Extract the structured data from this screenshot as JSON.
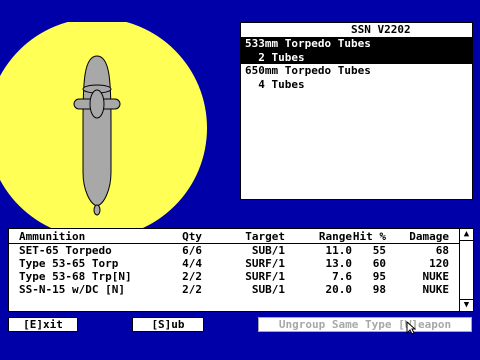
{
  "colors": {
    "background": "#0000a8",
    "sun": "#ffff55",
    "hull": "#a8a8a8",
    "panel": "#ffffff"
  },
  "mounts": {
    "title": "SSN V2202",
    "items": [
      {
        "name": "533mm Torpedo Tubes",
        "count": "2 Tubes",
        "selected": true
      },
      {
        "name": "650mm Torpedo Tubes",
        "count": "4 Tubes",
        "selected": false
      }
    ]
  },
  "ammo": {
    "headers": {
      "name": "Ammunition",
      "qty": "Qty",
      "target": "Target",
      "range": "Range",
      "hit": "Hit %",
      "damage": "Damage"
    },
    "rows": [
      {
        "name": "SET-65 Torpedo",
        "qty": "6/6",
        "target": "SUB/1",
        "range": "11.0",
        "hit": "55",
        "damage": "68"
      },
      {
        "name": "Type 53-65 Torp",
        "qty": "4/4",
        "target": "SURF/1",
        "range": "13.0",
        "hit": "60",
        "damage": "120"
      },
      {
        "name": "Type 53-68 Trp[N]",
        "qty": "2/2",
        "target": "SURF/1",
        "range": "7.6",
        "hit": "95",
        "damage": "NUKE"
      },
      {
        "name": "SS-N-15 w/DC [N]",
        "qty": "2/2",
        "target": "SUB/1",
        "range": "20.0",
        "hit": "98",
        "damage": "NUKE"
      }
    ],
    "scroll_up_icon": "arrow-up-icon",
    "scroll_down_icon": "arrow-down-icon"
  },
  "buttons": {
    "exit": "[E]xit",
    "sub": "[S]ub",
    "ungroup": "Ungroup Same Type [W]eapon"
  }
}
